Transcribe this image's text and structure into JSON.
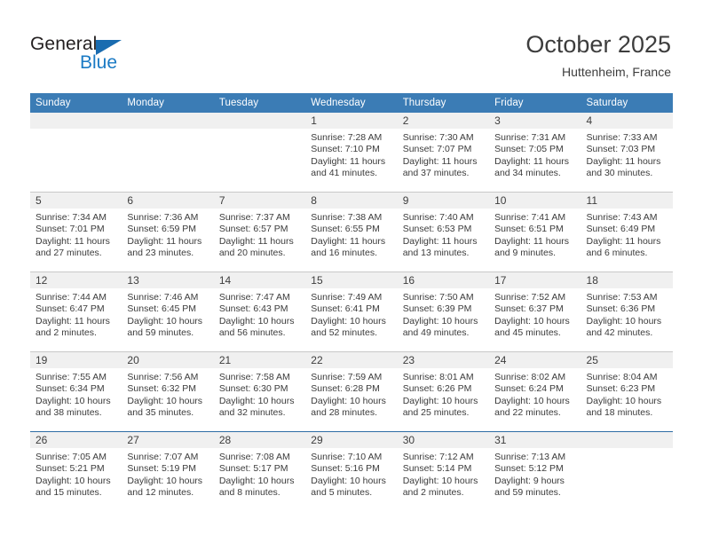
{
  "brand": {
    "line1": "General",
    "line2": "Blue",
    "triangle_color": "#1a6cb0",
    "text_color": "#231f20",
    "blue_color": "#1a7ac4"
  },
  "header": {
    "title": "October 2025",
    "subtitle": "Huttenheim, France"
  },
  "theme": {
    "header_bg": "#3b7cb5",
    "daynum_bg": "#f0f0f0",
    "row_border": "#c8c8c8",
    "last_row_border": "#2e6da4",
    "text": "#3b3b3b"
  },
  "labels": {
    "sunrise_prefix": "Sunrise:",
    "sunset_prefix": "Sunset:",
    "daylight_prefix": "Daylight:"
  },
  "weekday_headers": [
    "Sunday",
    "Monday",
    "Tuesday",
    "Wednesday",
    "Thursday",
    "Friday",
    "Saturday"
  ],
  "weeks": [
    [
      {
        "day": "",
        "sunrise": "",
        "sunset": "",
        "daylight_line1": "",
        "daylight_line2": ""
      },
      {
        "day": "",
        "sunrise": "",
        "sunset": "",
        "daylight_line1": "",
        "daylight_line2": ""
      },
      {
        "day": "",
        "sunrise": "",
        "sunset": "",
        "daylight_line1": "",
        "daylight_line2": ""
      },
      {
        "day": "1",
        "sunrise": "Sunrise: 7:28 AM",
        "sunset": "Sunset: 7:10 PM",
        "daylight_line1": "Daylight: 11 hours",
        "daylight_line2": "and 41 minutes."
      },
      {
        "day": "2",
        "sunrise": "Sunrise: 7:30 AM",
        "sunset": "Sunset: 7:07 PM",
        "daylight_line1": "Daylight: 11 hours",
        "daylight_line2": "and 37 minutes."
      },
      {
        "day": "3",
        "sunrise": "Sunrise: 7:31 AM",
        "sunset": "Sunset: 7:05 PM",
        "daylight_line1": "Daylight: 11 hours",
        "daylight_line2": "and 34 minutes."
      },
      {
        "day": "4",
        "sunrise": "Sunrise: 7:33 AM",
        "sunset": "Sunset: 7:03 PM",
        "daylight_line1": "Daylight: 11 hours",
        "daylight_line2": "and 30 minutes."
      }
    ],
    [
      {
        "day": "5",
        "sunrise": "Sunrise: 7:34 AM",
        "sunset": "Sunset: 7:01 PM",
        "daylight_line1": "Daylight: 11 hours",
        "daylight_line2": "and 27 minutes."
      },
      {
        "day": "6",
        "sunrise": "Sunrise: 7:36 AM",
        "sunset": "Sunset: 6:59 PM",
        "daylight_line1": "Daylight: 11 hours",
        "daylight_line2": "and 23 minutes."
      },
      {
        "day": "7",
        "sunrise": "Sunrise: 7:37 AM",
        "sunset": "Sunset: 6:57 PM",
        "daylight_line1": "Daylight: 11 hours",
        "daylight_line2": "and 20 minutes."
      },
      {
        "day": "8",
        "sunrise": "Sunrise: 7:38 AM",
        "sunset": "Sunset: 6:55 PM",
        "daylight_line1": "Daylight: 11 hours",
        "daylight_line2": "and 16 minutes."
      },
      {
        "day": "9",
        "sunrise": "Sunrise: 7:40 AM",
        "sunset": "Sunset: 6:53 PM",
        "daylight_line1": "Daylight: 11 hours",
        "daylight_line2": "and 13 minutes."
      },
      {
        "day": "10",
        "sunrise": "Sunrise: 7:41 AM",
        "sunset": "Sunset: 6:51 PM",
        "daylight_line1": "Daylight: 11 hours",
        "daylight_line2": "and 9 minutes."
      },
      {
        "day": "11",
        "sunrise": "Sunrise: 7:43 AM",
        "sunset": "Sunset: 6:49 PM",
        "daylight_line1": "Daylight: 11 hours",
        "daylight_line2": "and 6 minutes."
      }
    ],
    [
      {
        "day": "12",
        "sunrise": "Sunrise: 7:44 AM",
        "sunset": "Sunset: 6:47 PM",
        "daylight_line1": "Daylight: 11 hours",
        "daylight_line2": "and 2 minutes."
      },
      {
        "day": "13",
        "sunrise": "Sunrise: 7:46 AM",
        "sunset": "Sunset: 6:45 PM",
        "daylight_line1": "Daylight: 10 hours",
        "daylight_line2": "and 59 minutes."
      },
      {
        "day": "14",
        "sunrise": "Sunrise: 7:47 AM",
        "sunset": "Sunset: 6:43 PM",
        "daylight_line1": "Daylight: 10 hours",
        "daylight_line2": "and 56 minutes."
      },
      {
        "day": "15",
        "sunrise": "Sunrise: 7:49 AM",
        "sunset": "Sunset: 6:41 PM",
        "daylight_line1": "Daylight: 10 hours",
        "daylight_line2": "and 52 minutes."
      },
      {
        "day": "16",
        "sunrise": "Sunrise: 7:50 AM",
        "sunset": "Sunset: 6:39 PM",
        "daylight_line1": "Daylight: 10 hours",
        "daylight_line2": "and 49 minutes."
      },
      {
        "day": "17",
        "sunrise": "Sunrise: 7:52 AM",
        "sunset": "Sunset: 6:37 PM",
        "daylight_line1": "Daylight: 10 hours",
        "daylight_line2": "and 45 minutes."
      },
      {
        "day": "18",
        "sunrise": "Sunrise: 7:53 AM",
        "sunset": "Sunset: 6:36 PM",
        "daylight_line1": "Daylight: 10 hours",
        "daylight_line2": "and 42 minutes."
      }
    ],
    [
      {
        "day": "19",
        "sunrise": "Sunrise: 7:55 AM",
        "sunset": "Sunset: 6:34 PM",
        "daylight_line1": "Daylight: 10 hours",
        "daylight_line2": "and 38 minutes."
      },
      {
        "day": "20",
        "sunrise": "Sunrise: 7:56 AM",
        "sunset": "Sunset: 6:32 PM",
        "daylight_line1": "Daylight: 10 hours",
        "daylight_line2": "and 35 minutes."
      },
      {
        "day": "21",
        "sunrise": "Sunrise: 7:58 AM",
        "sunset": "Sunset: 6:30 PM",
        "daylight_line1": "Daylight: 10 hours",
        "daylight_line2": "and 32 minutes."
      },
      {
        "day": "22",
        "sunrise": "Sunrise: 7:59 AM",
        "sunset": "Sunset: 6:28 PM",
        "daylight_line1": "Daylight: 10 hours",
        "daylight_line2": "and 28 minutes."
      },
      {
        "day": "23",
        "sunrise": "Sunrise: 8:01 AM",
        "sunset": "Sunset: 6:26 PM",
        "daylight_line1": "Daylight: 10 hours",
        "daylight_line2": "and 25 minutes."
      },
      {
        "day": "24",
        "sunrise": "Sunrise: 8:02 AM",
        "sunset": "Sunset: 6:24 PM",
        "daylight_line1": "Daylight: 10 hours",
        "daylight_line2": "and 22 minutes."
      },
      {
        "day": "25",
        "sunrise": "Sunrise: 8:04 AM",
        "sunset": "Sunset: 6:23 PM",
        "daylight_line1": "Daylight: 10 hours",
        "daylight_line2": "and 18 minutes."
      }
    ],
    [
      {
        "day": "26",
        "sunrise": "Sunrise: 7:05 AM",
        "sunset": "Sunset: 5:21 PM",
        "daylight_line1": "Daylight: 10 hours",
        "daylight_line2": "and 15 minutes."
      },
      {
        "day": "27",
        "sunrise": "Sunrise: 7:07 AM",
        "sunset": "Sunset: 5:19 PM",
        "daylight_line1": "Daylight: 10 hours",
        "daylight_line2": "and 12 minutes."
      },
      {
        "day": "28",
        "sunrise": "Sunrise: 7:08 AM",
        "sunset": "Sunset: 5:17 PM",
        "daylight_line1": "Daylight: 10 hours",
        "daylight_line2": "and 8 minutes."
      },
      {
        "day": "29",
        "sunrise": "Sunrise: 7:10 AM",
        "sunset": "Sunset: 5:16 PM",
        "daylight_line1": "Daylight: 10 hours",
        "daylight_line2": "and 5 minutes."
      },
      {
        "day": "30",
        "sunrise": "Sunrise: 7:12 AM",
        "sunset": "Sunset: 5:14 PM",
        "daylight_line1": "Daylight: 10 hours",
        "daylight_line2": "and 2 minutes."
      },
      {
        "day": "31",
        "sunrise": "Sunrise: 7:13 AM",
        "sunset": "Sunset: 5:12 PM",
        "daylight_line1": "Daylight: 9 hours",
        "daylight_line2": "and 59 minutes."
      },
      {
        "day": "",
        "sunrise": "",
        "sunset": "",
        "daylight_line1": "",
        "daylight_line2": ""
      }
    ]
  ]
}
